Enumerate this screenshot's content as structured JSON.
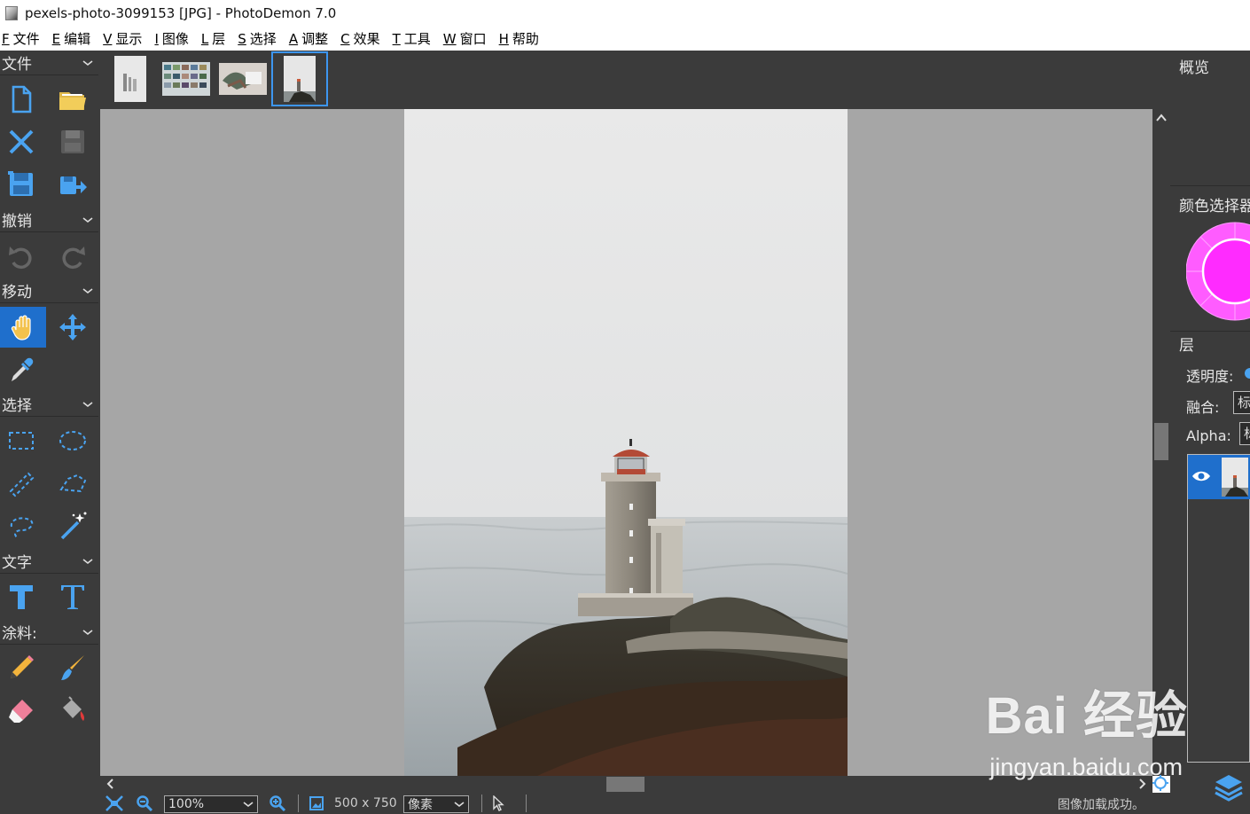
{
  "window": {
    "title": "pexels-photo-3099153 [JPG]  -  PhotoDemon 7.0"
  },
  "menu": [
    {
      "key": "F",
      "label": "文件"
    },
    {
      "key": "E",
      "label": "编辑"
    },
    {
      "key": "V",
      "label": "显示"
    },
    {
      "key": "I",
      "label": "图像"
    },
    {
      "key": "L",
      "label": "层"
    },
    {
      "key": "S",
      "label": "选择"
    },
    {
      "key": "A",
      "label": "调整"
    },
    {
      "key": "C",
      "label": "效果"
    },
    {
      "key": "T",
      "label": "工具"
    },
    {
      "key": "W",
      "label": "窗口"
    },
    {
      "key": "H",
      "label": "帮助"
    }
  ],
  "toolbox": {
    "sections": [
      "文件",
      "撤销",
      "移动",
      "选择",
      "文字",
      "涂料:"
    ],
    "file_tools": [
      "new-file-icon",
      "open-folder-icon",
      "close-icon",
      "save-icon",
      "save-as-icon",
      "export-icon"
    ],
    "undo_tools": [
      "undo-icon",
      "redo-icon"
    ],
    "move_tools": [
      "hand-icon",
      "move-arrows-icon",
      "eyedropper-icon"
    ],
    "select_tools": [
      "rect-select-icon",
      "ellipse-select-icon",
      "line-select-icon",
      "polygon-select-icon",
      "lasso-icon",
      "magic-wand-icon"
    ],
    "text_tools": [
      "basic-text-icon",
      "typography-icon"
    ],
    "paint_tools": [
      "pencil-icon",
      "brush-icon",
      "eraser-icon",
      "fill-bucket-icon"
    ]
  },
  "status": {
    "zoom": "100%",
    "size": "500 x 750",
    "unit": "像素",
    "message": "图像加载成功。"
  },
  "right_panel": {
    "overview_title": "概览",
    "color_title": "颜色选择器",
    "layers_title": "层",
    "opacity_label": "透明度:",
    "blend_label": "融合:",
    "blend_value": "标",
    "alpha_label": "Alpha:",
    "alpha_value": "标"
  },
  "watermark": {
    "brand": "Bai 经验",
    "url": "jingyan.baidu.com"
  },
  "colors": {
    "panel": "#3b3b3b",
    "accent": "#1f6fcc",
    "canvas": "#a6a6a6",
    "picker": "#ff2bff"
  }
}
